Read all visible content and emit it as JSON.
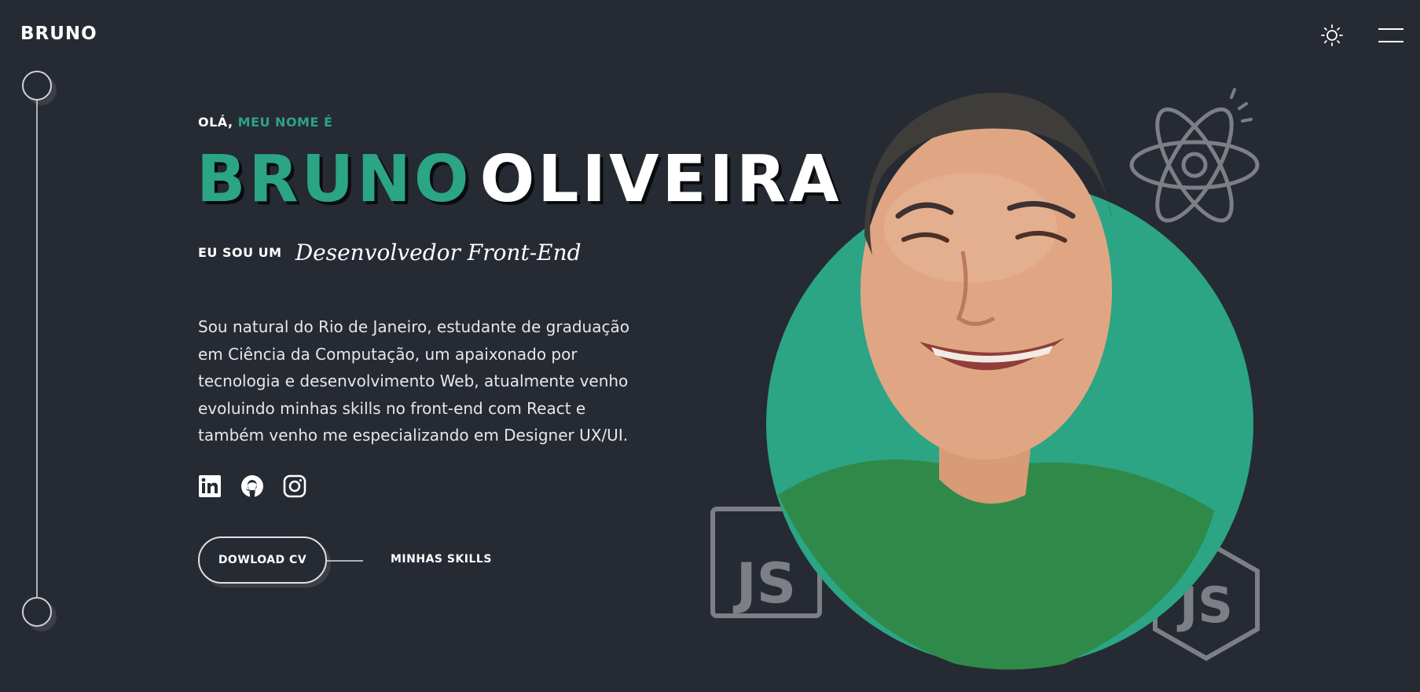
{
  "header": {
    "logo": "BRUNO",
    "theme_icon": "sun-icon",
    "menu_icon": "hamburger-menu-icon"
  },
  "hero": {
    "greeting_prefix": "OLÁ,",
    "greeting_accent": "MEU NOME É",
    "first_name": "BRUNO",
    "last_name": "OLIVEIRA",
    "role_prefix": "EU SOU UM",
    "role_title": "Desenvolvedor Front-End",
    "bio": "Sou natural do Rio de Janeiro, estudante de graduação em Ciência da Computação, um apaixonado por tecnologia e desenvolvimento Web, atualmente venho evoluindo minhas skills no front-end com React e também venho me especializando em Designer UX/UI.",
    "socials": [
      {
        "icon": "linkedin-icon"
      },
      {
        "icon": "github-icon"
      },
      {
        "icon": "instagram-icon"
      }
    ],
    "cv_button": "DOWLOAD CV",
    "skills_link": "MINHAS SKILLS",
    "portrait": "profile-photo",
    "decorations": {
      "atom_icon": "react-icon",
      "js_square_icon": "javascript-icon",
      "js_hex_icon": "nodejs-icon"
    }
  },
  "colors": {
    "background": "#262a33",
    "accent": "#2ba584",
    "text": "#ffffff",
    "decor": "#7c7f86"
  }
}
